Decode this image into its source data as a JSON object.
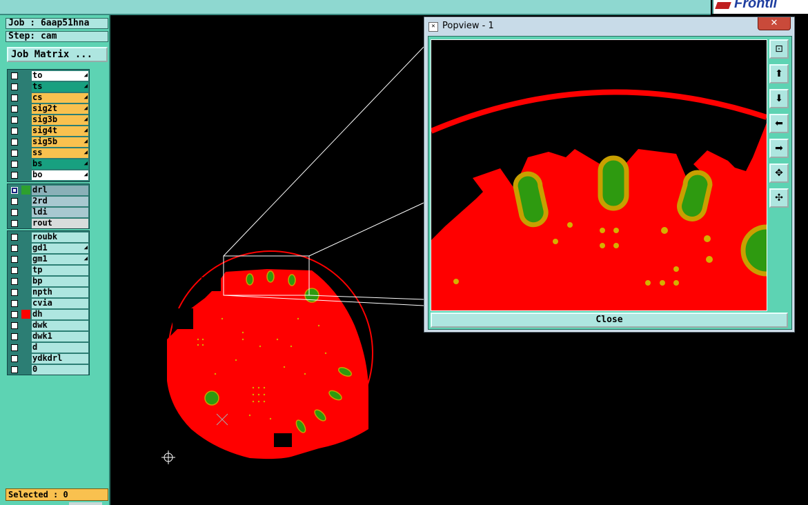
{
  "job": {
    "label": "Job : 6aap51hna"
  },
  "step": {
    "label": "Step: cam"
  },
  "job_matrix_button": "Job Matrix ...",
  "brand_fragment": "Frontli",
  "layers_group1": [
    {
      "name": "to",
      "color": "#ffffff",
      "marked": true
    },
    {
      "name": "ts",
      "color": "#18a080",
      "marked": true
    },
    {
      "name": "cs",
      "color": "#f9c14f",
      "marked": true
    },
    {
      "name": "sig2t",
      "color": "#f9c14f",
      "marked": true
    },
    {
      "name": "sig3b",
      "color": "#f9c14f",
      "marked": true
    },
    {
      "name": "sig4t",
      "color": "#f9c14f",
      "marked": true
    },
    {
      "name": "sig5b",
      "color": "#f9c14f",
      "marked": true
    },
    {
      "name": "ss",
      "color": "#f9c14f",
      "marked": true
    },
    {
      "name": "bs",
      "color": "#18a080",
      "marked": true
    },
    {
      "name": "bo",
      "color": "#ffffff",
      "marked": true
    }
  ],
  "layers_group2": [
    {
      "name": "drl",
      "color": "#8ab0b8",
      "swatch": "#2ea02e",
      "selected": true
    },
    {
      "name": "2rd",
      "color": "#a8c8d0"
    },
    {
      "name": "ldi",
      "color": "#a8c8d0"
    },
    {
      "name": "rout",
      "color": "#d8dcdc"
    }
  ],
  "layers_group3": [
    {
      "name": "roubk",
      "color": "#aee6e0"
    },
    {
      "name": "gd1",
      "color": "#aee6e0",
      "marked": true
    },
    {
      "name": "gm1",
      "color": "#aee6e0",
      "marked": true
    },
    {
      "name": "tp",
      "color": "#aee6e0"
    },
    {
      "name": "bp",
      "color": "#aee6e0"
    },
    {
      "name": "npth",
      "color": "#aee6e0"
    },
    {
      "name": "cvia",
      "color": "#aee6e0"
    },
    {
      "name": "dh",
      "color": "#aee6e0",
      "swatch": "#ff0000"
    },
    {
      "name": "dwk",
      "color": "#aee6e0"
    },
    {
      "name": "dwk1",
      "color": "#aee6e0"
    },
    {
      "name": "d",
      "color": "#aee6e0"
    },
    {
      "name": "ydkdrl",
      "color": "#aee6e0"
    },
    {
      "name": "0",
      "color": "#aee6e0"
    }
  ],
  "status": {
    "selected": "Selected : 0"
  },
  "popview": {
    "title": "Popview - 1",
    "close_x": "✕",
    "close_button": "Close",
    "tools": [
      "zoom-fit-icon",
      "pan-up-icon",
      "pan-down-icon",
      "pan-left-icon",
      "pan-right-icon",
      "zoom-in-icon",
      "zoom-out-icon"
    ]
  },
  "colors": {
    "copper": "#ff0000",
    "pad": "#2e9a10",
    "pad_ring": "#c8a000",
    "via": "#d4b000",
    "panel": "#5dd3b3"
  }
}
